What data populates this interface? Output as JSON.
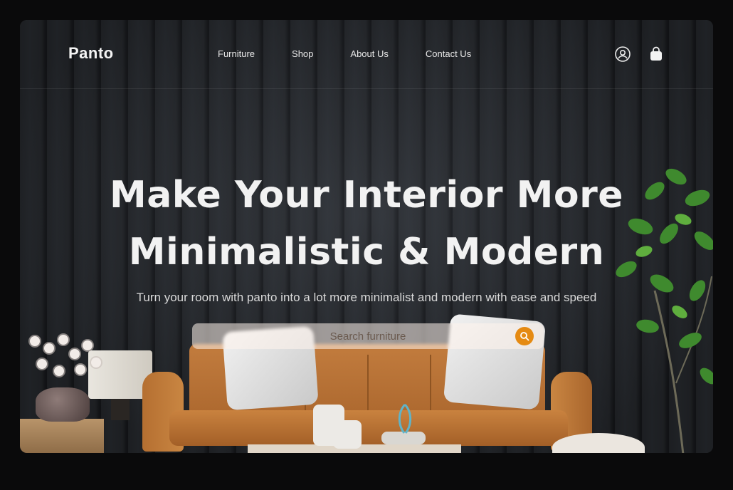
{
  "brand": {
    "name": "Panto"
  },
  "nav": {
    "items": [
      {
        "label": "Furniture"
      },
      {
        "label": "Shop"
      },
      {
        "label": "About Us"
      },
      {
        "label": "Contact Us"
      }
    ]
  },
  "header_icons": {
    "account": "user-circle-icon",
    "cart": "shopping-bag-icon"
  },
  "hero": {
    "headline_line1": "Make Your Interior More",
    "headline_line2": "Minimalistic & Modern",
    "subtitle": "Turn your room with panto into a lot more minimalist and modern with ease and speed"
  },
  "search": {
    "placeholder": "Search furniture",
    "button_icon": "search-icon"
  },
  "colors": {
    "accent": "#e58a12",
    "wall": "#2a2d31",
    "sofa": "#c27c3e"
  }
}
